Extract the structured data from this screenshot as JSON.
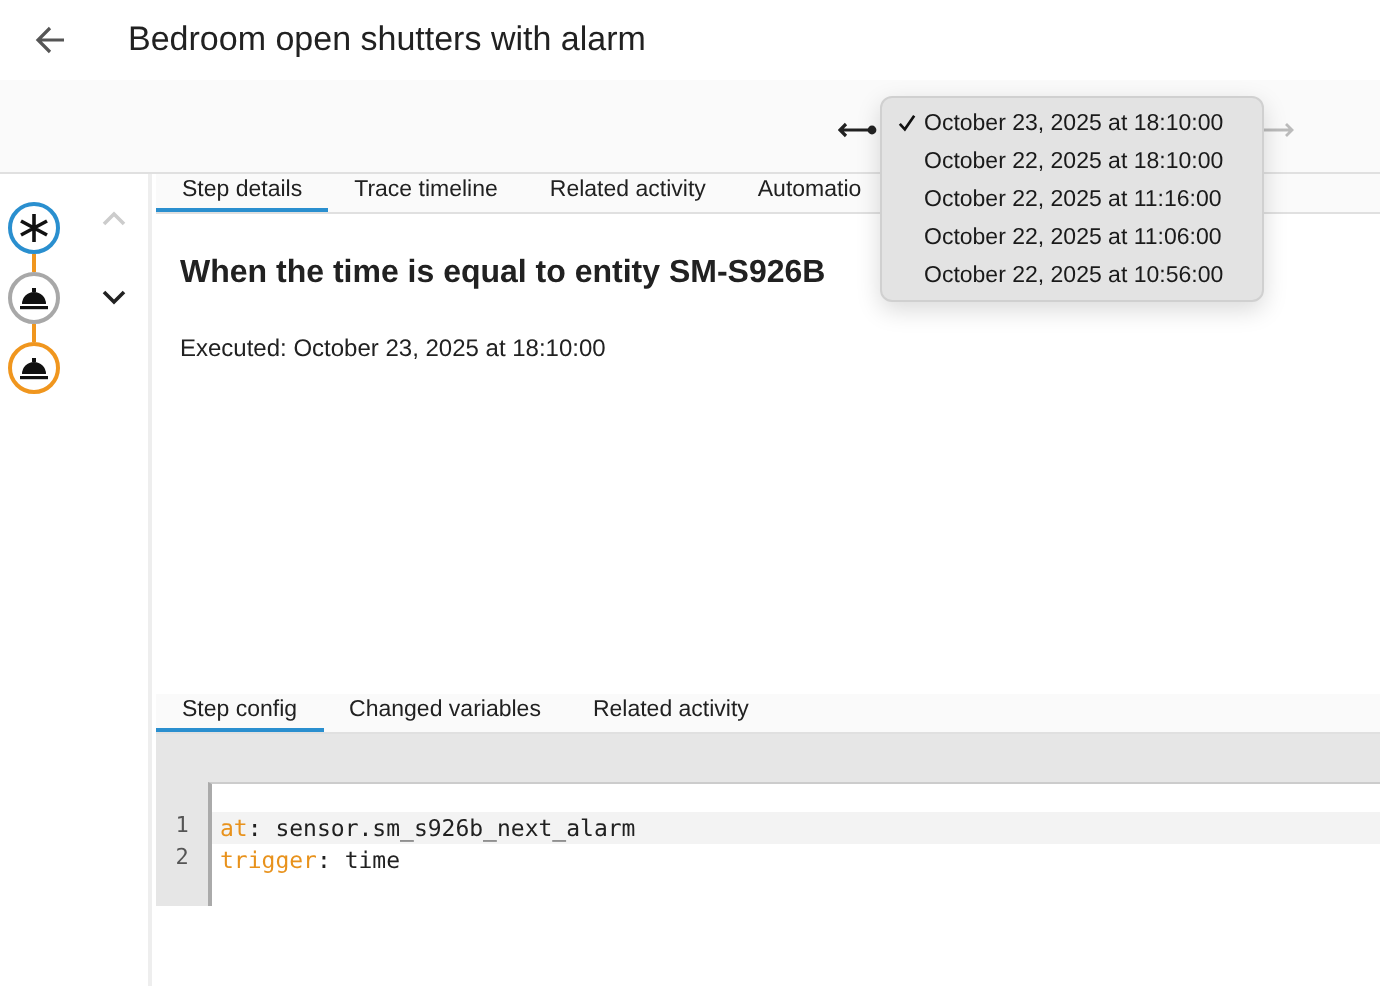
{
  "header": {
    "title": "Bedroom open shutters with alarm"
  },
  "trace_picker": {
    "options": [
      {
        "label": "October 23, 2025 at 18:10:00",
        "selected": true
      },
      {
        "label": "October 22, 2025 at 18:10:00",
        "selected": false
      },
      {
        "label": "October 22, 2025 at 11:16:00",
        "selected": false
      },
      {
        "label": "October 22, 2025 at 11:06:00",
        "selected": false
      },
      {
        "label": "October 22, 2025 at 10:56:00",
        "selected": false
      }
    ]
  },
  "graph": {
    "nodes": [
      {
        "kind": "trigger",
        "color": "#2a8fcf"
      },
      {
        "kind": "action",
        "color": "#a8a8a8"
      },
      {
        "kind": "action",
        "color": "#f0961e"
      }
    ],
    "nav": [
      {
        "kind": "up",
        "disabled": true
      },
      {
        "kind": "down",
        "disabled": false
      }
    ]
  },
  "tabs": [
    {
      "label": "Step details",
      "selected": true
    },
    {
      "label": "Trace timeline",
      "selected": false
    },
    {
      "label": "Related activity",
      "selected": false
    },
    {
      "label": "Automatio",
      "selected": false
    }
  ],
  "step": {
    "title": "When the time is equal to entity SM-S926B",
    "executed": "Executed: October 23, 2025 at 18:10:00"
  },
  "config_tabs": [
    {
      "label": "Step config",
      "selected": true
    },
    {
      "label": "Changed variables",
      "selected": false
    },
    {
      "label": "Related activity",
      "selected": false
    }
  ],
  "code_lines": [
    {
      "number": "1",
      "key": "at",
      "rest": ": sensor.sm_s926b_next_alarm",
      "active": true
    },
    {
      "number": "2",
      "key": "trigger",
      "rest": ": time",
      "active": false
    }
  ]
}
